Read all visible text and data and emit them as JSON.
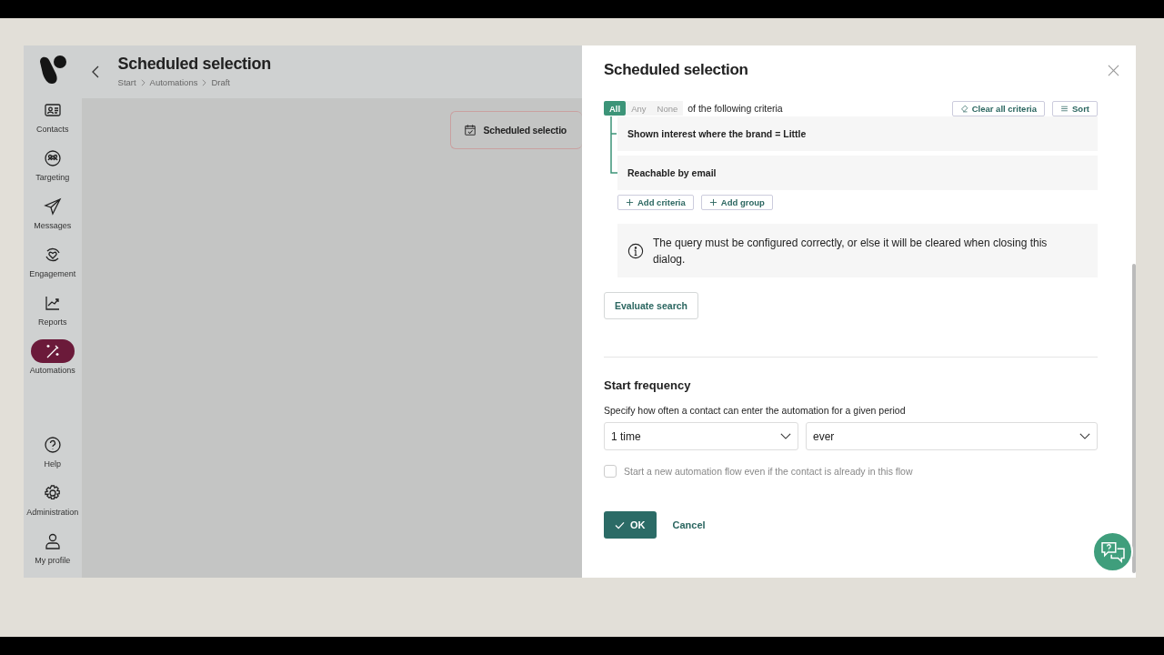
{
  "sidebar": {
    "items": [
      {
        "label": "Contacts",
        "selected": false
      },
      {
        "label": "Targeting",
        "selected": false
      },
      {
        "label": "Messages",
        "selected": false
      },
      {
        "label": "Engagement",
        "selected": false
      },
      {
        "label": "Reports",
        "selected": false
      },
      {
        "label": "Automations",
        "selected": true
      }
    ],
    "bottom_items": [
      {
        "label": "Help"
      },
      {
        "label": "Administration"
      },
      {
        "label": "My profile"
      }
    ]
  },
  "header": {
    "title": "Scheduled selection",
    "breadcrumbs": [
      "Start",
      "Automations",
      "Draft"
    ]
  },
  "canvas": {
    "node": {
      "label": "Scheduled selectio"
    }
  },
  "dialog": {
    "title": "Scheduled selection",
    "match_modes": [
      {
        "label": "All",
        "selected": true
      },
      {
        "label": "Any",
        "selected": false
      },
      {
        "label": "None",
        "selected": false
      }
    ],
    "match_suffix": "of the following criteria",
    "tools": [
      "Clear all criteria",
      "Sort"
    ],
    "criteria": [
      "Shown interest where the brand = Little",
      "Reachable by email"
    ],
    "add_buttons": [
      "Add criteria",
      "Add group"
    ],
    "info": "The query must be configured correctly, or else it will be cleared when closing this dialog.",
    "evaluate_button": "Evaluate search",
    "section_title": "Start frequency",
    "description": "Specify how often a contact can enter the automation for a given period",
    "selects": [
      {
        "value": "1 time"
      },
      {
        "value": "ever"
      }
    ],
    "checkbox": {
      "label": "Start a new automation flow even if the contact is already in this flow",
      "checked": false
    },
    "ok": "OK",
    "cancel": "Cancel"
  }
}
